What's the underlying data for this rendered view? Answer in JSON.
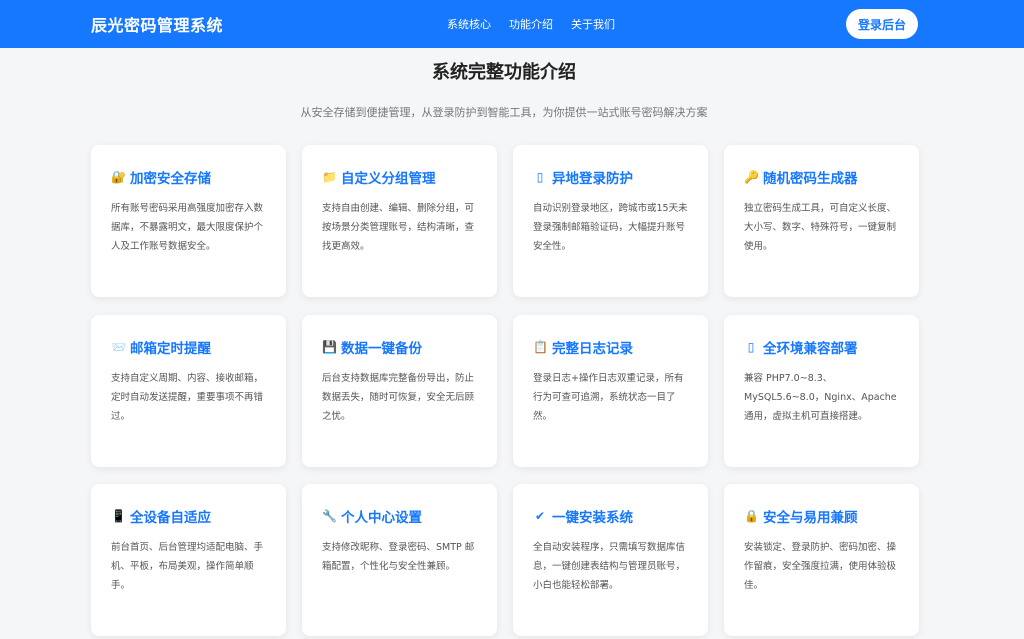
{
  "brand": "辰光密码管理系统",
  "nav": {
    "links": [
      "系统核心",
      "功能介绍",
      "关于我们"
    ],
    "login_label": "登录后台"
  },
  "section": {
    "title": "系统完整功能介绍",
    "subtitle": "从安全存储到便捷管理，从登录防护到智能工具，为你提供一站式账号密码解决方案"
  },
  "features": [
    {
      "icon": "lock-key-icon",
      "glyph": "🔐",
      "title": "加密安全存储",
      "desc": "所有账号密码采用高强度加密存入数据库，不暴露明文，最大限度保护个人及工作账号数据安全。"
    },
    {
      "icon": "folder-icon",
      "glyph": "📁",
      "title": "自定义分组管理",
      "desc": "支持自由创建、编辑、删除分组，可按场景分类管理账号，结构清晰，查找更高效。"
    },
    {
      "icon": "phone-icon",
      "glyph": "▯",
      "title": "异地登录防护",
      "desc": "自动识别登录地区，跨城市或15天未登录强制邮箱验证码，大幅提升账号安全性。"
    },
    {
      "icon": "key-icon",
      "glyph": "🔑",
      "title": "随机密码生成器",
      "desc": "独立密码生成工具，可自定义长度、大小写、数字、特殊符号，一键复制使用。"
    },
    {
      "icon": "mail-icon",
      "glyph": "📨",
      "title": "邮箱定时提醒",
      "desc": "支持自定义周期、内容、接收邮箱，定时自动发送提醒，重要事项不再错过。"
    },
    {
      "icon": "save-icon",
      "glyph": "💾",
      "title": "数据一键备份",
      "desc": "后台支持数据库完整备份导出，防止数据丢失，随时可恢复，安全无后顾之忧。"
    },
    {
      "icon": "clipboard-icon",
      "glyph": "📋",
      "title": "完整日志记录",
      "desc": "登录日志+操作日志双重记录，所有行为可查可追溯，系统状态一目了然。"
    },
    {
      "icon": "device-icon",
      "glyph": "▯",
      "title": "全环境兼容部署",
      "desc": "兼容 PHP7.0~8.3、MySQL5.6~8.0，Nginx、Apache 通用，虚拟主机可直接搭建。"
    },
    {
      "icon": "mobile-icon",
      "glyph": "📱",
      "title": "全设备自适应",
      "desc": "前台首页、后台管理均适配电脑、手机、平板，布局美观，操作简单顺手。"
    },
    {
      "icon": "wrench-icon",
      "glyph": "🔧",
      "title": "个人中心设置",
      "desc": "支持修改昵称、登录密码、SMTP 邮箱配置，个性化与安全性兼顾。"
    },
    {
      "icon": "check-icon",
      "glyph": "✔",
      "title": "一键安装系统",
      "desc": "全自动安装程序，只需填写数据库信息，一键创建表结构与管理员账号，小白也能轻松部署。"
    },
    {
      "icon": "padlock-icon",
      "glyph": "🔒",
      "title": "安全与易用兼顾",
      "desc": "安装锁定、登录防护、密码加密、操作留痕，安全强度拉满，使用体验极佳。"
    }
  ]
}
